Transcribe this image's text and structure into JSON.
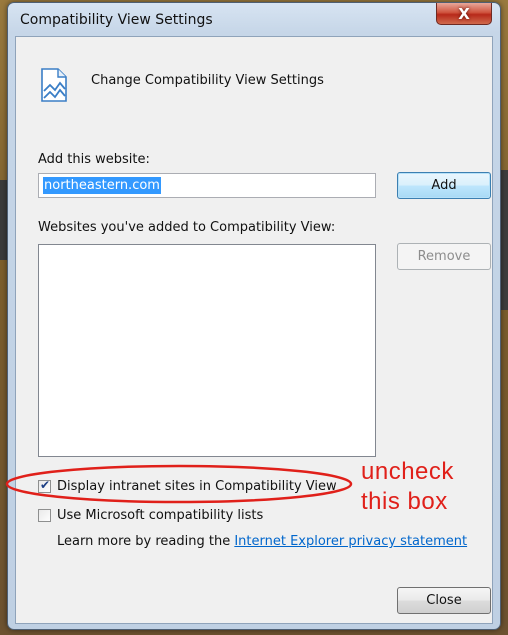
{
  "window": {
    "title": "Compatibility View Settings",
    "close_glyph": "X"
  },
  "header": {
    "icon": "compatibility-view-icon",
    "text": "Change Compatibility View Settings"
  },
  "add_section": {
    "label": "Add this website:",
    "input_value": "northeastern.com",
    "add_button": "Add"
  },
  "list_section": {
    "label": "Websites you've added to Compatibility View:",
    "items": [],
    "remove_button": "Remove"
  },
  "options": {
    "intranet_label": "Display intranet sites in Compatibility View",
    "intranet_checked": true,
    "microsoft_lists_label": "Use Microsoft compatibility lists",
    "microsoft_lists_checked": false
  },
  "learn_more": {
    "prefix": "Learn more by reading the ",
    "link": "Internet Explorer privacy statement"
  },
  "footer": {
    "close_button": "Close"
  },
  "annotation": {
    "line1": "uncheck",
    "line2": "this box",
    "color": "#e0201a"
  },
  "colors": {
    "title_close": "#c43c2a",
    "link": "#0066cc",
    "selection": "#3399ff"
  }
}
